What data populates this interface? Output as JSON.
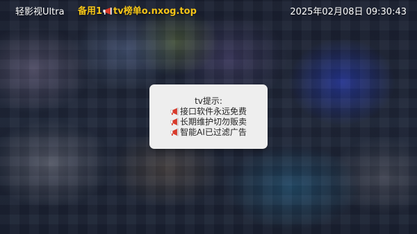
{
  "header": {
    "app_title": "轻影视Ultra",
    "source_label_prefix": "备用1",
    "source_label_suffix": "tv榜单o.nxog.top",
    "datetime": "2025年02月08日 09:30:43"
  },
  "dialog": {
    "title": "tv提示:",
    "lines": [
      "接口软件永远免费",
      "长期维护切勿贩卖",
      "智能AI已过滤广告"
    ]
  },
  "colors": {
    "accent_yellow": "#f5c518",
    "dialog_bg": "#eeeeee",
    "megaphone_red": "#d93a2b"
  },
  "icons": {
    "source_icon": "megaphone-icon",
    "line_icon": "megaphone-icon"
  }
}
